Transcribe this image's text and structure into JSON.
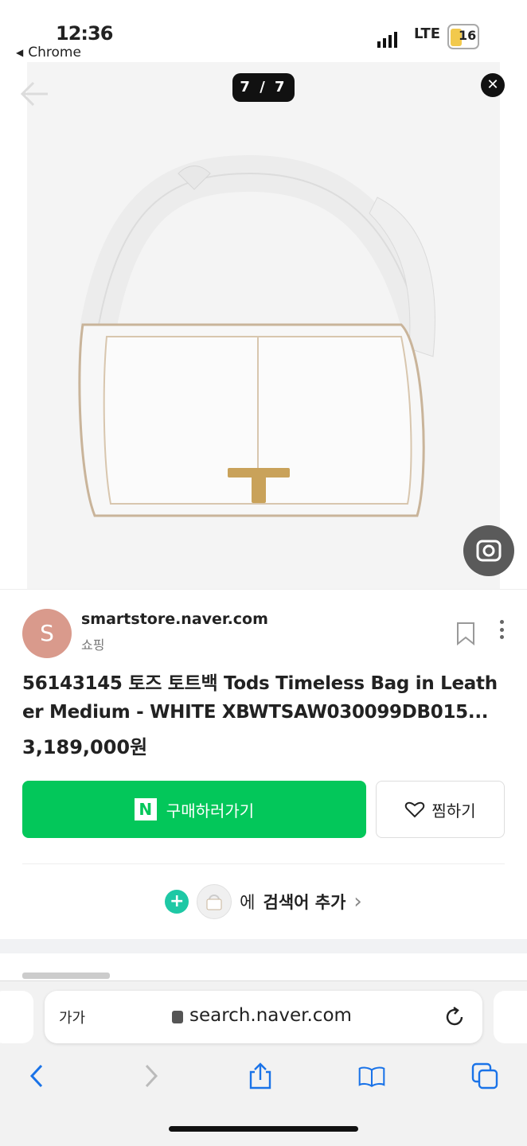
{
  "status_bar": {
    "time": "12:36",
    "back_app": "Chrome",
    "network": "LTE",
    "battery": "16"
  },
  "viewer": {
    "counter": "7 / 7",
    "product_image_description": "white leather tote bag with gold T clasp"
  },
  "result": {
    "avatar_letter": "S",
    "source_domain": "smartstore.naver.com",
    "category": "쇼핑",
    "title": "56143145 토즈 토트백 Tods Timeless Bag in Leather Medium - WHITE XBWTSAW030099DB015...",
    "price": "3,189,000원",
    "buy_button": "구매하러가기",
    "buy_icon_letter": "N",
    "wish_button": "찜하기",
    "add_search_prefix": "에",
    "add_search_label": "검색어 추가",
    "add_search_chevron": "›"
  },
  "browser": {
    "text_size_label": "가가",
    "url": "search.naver.com"
  },
  "colors": {
    "naver_green": "#03c75a",
    "add_teal": "#1ec8a5",
    "ios_blue": "#1a73e8"
  }
}
